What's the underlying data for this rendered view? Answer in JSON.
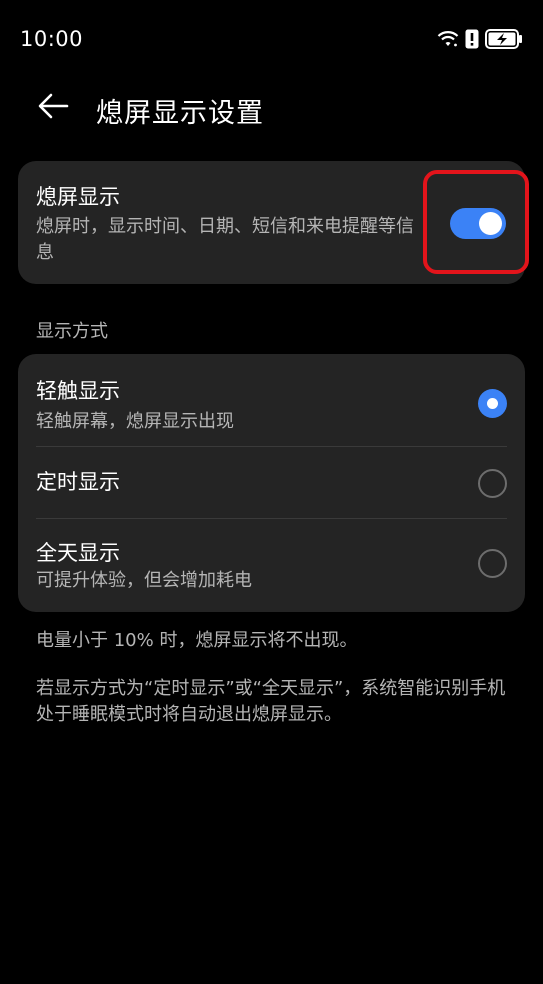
{
  "status_bar": {
    "time": "10:00",
    "icons": [
      "wifi-icon",
      "alert-icon",
      "battery-charging-icon"
    ]
  },
  "header": {
    "back_icon": "back-arrow-icon",
    "title": "熄屏显示设置"
  },
  "aod_card": {
    "title": "熄屏显示",
    "subtitle": "熄屏时，显示时间、日期、短信和来电提醒等信息",
    "toggle_on": true
  },
  "mode_section": {
    "label": "显示方式",
    "options": [
      {
        "title": "轻触显示",
        "subtitle": "轻触屏幕，熄屏显示出现",
        "selected": true
      },
      {
        "title": "定时显示",
        "subtitle": "",
        "selected": false
      },
      {
        "title": "全天显示",
        "subtitle": "可提升体验，但会增加耗电",
        "selected": false
      }
    ]
  },
  "notes": [
    "电量小于 10% 时，熄屏显示将不出现。",
    "若显示方式为“定时显示”或“全天显示”，系统智能识别手机处于睡眠模式时将自动退出熄屏显示。"
  ],
  "colors": {
    "background": "#000000",
    "card": "#242424",
    "accent": "#3b82f6",
    "highlight": "#e3141b",
    "secondary_text": "#b5b5b5"
  }
}
